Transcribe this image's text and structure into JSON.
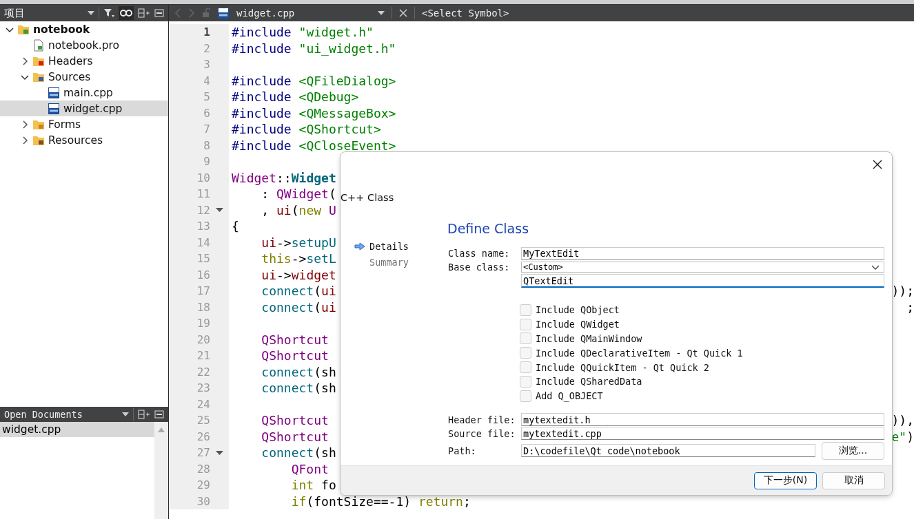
{
  "sidebar": {
    "title": "项目",
    "tree": [
      {
        "label": "notebook",
        "kind": "project",
        "expanded": true,
        "selected": false,
        "children": [
          {
            "label": "notebook.pro",
            "kind": "profile",
            "selected": false
          },
          {
            "label": "Headers",
            "kind": "folder",
            "expanded": false,
            "selected": false
          },
          {
            "label": "Sources",
            "kind": "folder",
            "expanded": true,
            "selected": false,
            "children": [
              {
                "label": "main.cpp",
                "kind": "source",
                "selected": false
              },
              {
                "label": "widget.cpp",
                "kind": "source",
                "selected": true
              }
            ]
          },
          {
            "label": "Forms",
            "kind": "folder",
            "expanded": false,
            "selected": false
          },
          {
            "label": "Resources",
            "kind": "folder",
            "expanded": false,
            "selected": false
          }
        ]
      }
    ]
  },
  "open_documents": {
    "title": "Open Documents",
    "items": [
      {
        "label": "widget.cpp",
        "selected": true
      }
    ]
  },
  "editor_tab": {
    "file": "widget.cpp",
    "symbol": "<Select Symbol>"
  },
  "editor": {
    "lines": [
      {
        "n": "1",
        "current": true,
        "fold": false,
        "code": [
          {
            "kind": "pp",
            "t": "#include"
          },
          {
            "kind": "str",
            "t": " \"widget.h\""
          }
        ]
      },
      {
        "n": "2",
        "current": false,
        "fold": false,
        "code": [
          {
            "kind": "pp",
            "t": "#include"
          },
          {
            "kind": "str",
            "t": " \"ui_widget.h\""
          }
        ]
      },
      {
        "n": "3",
        "current": false,
        "fold": false
      },
      {
        "n": "4",
        "current": false,
        "fold": false,
        "code": [
          {
            "kind": "pp",
            "t": "#include"
          },
          {
            "kind": "str",
            "t": " <QFileDialog>"
          }
        ]
      },
      {
        "n": "5",
        "current": false,
        "fold": false,
        "code": [
          {
            "kind": "pp",
            "t": "#include"
          },
          {
            "kind": "str",
            "t": " <QDebug>"
          }
        ]
      },
      {
        "n": "6",
        "current": false,
        "fold": false,
        "code": [
          {
            "kind": "pp",
            "t": "#include"
          },
          {
            "kind": "str",
            "t": " <QMessageBox>"
          }
        ]
      },
      {
        "n": "7",
        "current": false,
        "fold": false,
        "code": [
          {
            "kind": "pp",
            "t": "#include"
          },
          {
            "kind": "str",
            "t": " <QShortcut>"
          }
        ]
      },
      {
        "n": "8",
        "current": false,
        "fold": false,
        "code": [
          {
            "kind": "pp",
            "t": "#include"
          },
          {
            "kind": "str",
            "t": " <QCloseEvent>"
          }
        ]
      },
      {
        "n": "9",
        "current": false,
        "fold": false
      },
      {
        "n": "10",
        "current": false,
        "fold": false,
        "code": [
          {
            "kind": "type",
            "t": "Widget"
          },
          {
            "kind": "plain",
            "t": "::"
          },
          {
            "kind": "fnb",
            "t": "Widget"
          }
        ]
      },
      {
        "n": "11",
        "current": false,
        "fold": false,
        "code": [
          {
            "kind": "plain",
            "t": "    : "
          },
          {
            "kind": "type",
            "t": "QWidget"
          },
          {
            "kind": "plain",
            "t": "("
          }
        ]
      },
      {
        "n": "12",
        "current": false,
        "fold": true,
        "code": [
          {
            "kind": "plain",
            "t": "    , "
          },
          {
            "kind": "member",
            "t": "ui"
          },
          {
            "kind": "plain",
            "t": "("
          },
          {
            "kind": "kw",
            "t": "new"
          },
          {
            "kind": "type",
            "t": " U"
          }
        ]
      },
      {
        "n": "13",
        "current": false,
        "fold": false,
        "code": [
          {
            "kind": "plain",
            "t": "{"
          }
        ]
      },
      {
        "n": "14",
        "current": false,
        "fold": false,
        "code": [
          {
            "kind": "member",
            "t": "    ui"
          },
          {
            "kind": "plain",
            "t": "->"
          },
          {
            "kind": "fn",
            "t": "setupU"
          }
        ]
      },
      {
        "n": "15",
        "current": false,
        "fold": false,
        "code": [
          {
            "kind": "kw",
            "t": "    this"
          },
          {
            "kind": "plain",
            "t": "->"
          },
          {
            "kind": "fn",
            "t": "setL"
          }
        ]
      },
      {
        "n": "16",
        "current": false,
        "fold": false,
        "code": [
          {
            "kind": "member",
            "t": "    ui"
          },
          {
            "kind": "plain",
            "t": "->"
          },
          {
            "kind": "member",
            "t": "widget"
          }
        ]
      },
      {
        "n": "17",
        "current": false,
        "fold": false,
        "code": [
          {
            "kind": "fn",
            "t": "    connect"
          },
          {
            "kind": "plain",
            "t": "("
          },
          {
            "kind": "member",
            "t": "ui"
          }
        ],
        "tail": [
          {
            "kind": "plain",
            "t": "));"
          }
        ]
      },
      {
        "n": "18",
        "current": false,
        "fold": false,
        "code": [
          {
            "kind": "fn",
            "t": "    connect"
          },
          {
            "kind": "plain",
            "t": "("
          },
          {
            "kind": "member",
            "t": "ui"
          }
        ],
        "tail": [
          {
            "kind": "plain",
            "t": ";"
          }
        ]
      },
      {
        "n": "19",
        "current": false,
        "fold": false
      },
      {
        "n": "20",
        "current": false,
        "fold": false,
        "code": [
          {
            "kind": "type",
            "t": "    QShortcut"
          }
        ]
      },
      {
        "n": "21",
        "current": false,
        "fold": false,
        "code": [
          {
            "kind": "type",
            "t": "    QShortcut"
          }
        ]
      },
      {
        "n": "22",
        "current": false,
        "fold": false,
        "code": [
          {
            "kind": "fn",
            "t": "    connect"
          },
          {
            "kind": "plain",
            "t": "(sh"
          }
        ]
      },
      {
        "n": "23",
        "current": false,
        "fold": false,
        "code": [
          {
            "kind": "fn",
            "t": "    connect"
          },
          {
            "kind": "plain",
            "t": "(sh"
          }
        ]
      },
      {
        "n": "24",
        "current": false,
        "fold": false
      },
      {
        "n": "25",
        "current": false,
        "fold": false,
        "code": [
          {
            "kind": "type",
            "t": "    QShortcut"
          }
        ],
        "tail": [
          {
            "kind": "plain",
            "t": ")),"
          }
        ]
      },
      {
        "n": "26",
        "current": false,
        "fold": false,
        "code": [
          {
            "kind": "type",
            "t": "    QShortcut"
          }
        ],
        "tail": [
          {
            "kind": "str",
            "t": "e\""
          },
          {
            "kind": "plain",
            "t": ")"
          }
        ]
      },
      {
        "n": "27",
        "current": false,
        "fold": true,
        "code": [
          {
            "kind": "fn",
            "t": "    connect"
          },
          {
            "kind": "plain",
            "t": "(sh"
          }
        ]
      },
      {
        "n": "28",
        "current": false,
        "fold": false,
        "code": [
          {
            "kind": "type",
            "t": "        QFont"
          }
        ]
      },
      {
        "n": "29",
        "current": false,
        "fold": false,
        "code": [
          {
            "kind": "kw",
            "t": "        int"
          },
          {
            "kind": "plain",
            "t": " fo"
          }
        ]
      },
      {
        "n": "30",
        "current": false,
        "fold": false,
        "code": [
          {
            "kind": "kw",
            "t": "        if"
          },
          {
            "kind": "plain",
            "t": "(fontSize==-1) "
          },
          {
            "kind": "kw",
            "t": "return"
          },
          {
            "kind": "plain",
            "t": ";"
          }
        ]
      }
    ]
  },
  "dialog": {
    "title": "C++ Class",
    "steps": [
      {
        "label": "Details",
        "selected": true
      },
      {
        "label": "Summary",
        "selected": false
      }
    ],
    "heading": "Define Class",
    "class_name": {
      "label": "Class name:",
      "value": "MyTextEdit"
    },
    "base_class": {
      "label": "Base class:",
      "value": "<Custom>"
    },
    "custom_base": {
      "value": "QTextEdit"
    },
    "options": [
      {
        "label": "Include QObject",
        "checked": false
      },
      {
        "label": "Include QWidget",
        "checked": false
      },
      {
        "label": "Include QMainWindow",
        "checked": false
      },
      {
        "label": "Include QDeclarativeItem - Qt Quick 1",
        "checked": false
      },
      {
        "label": "Include QQuickItem - Qt Quick 2",
        "checked": false
      },
      {
        "label": "Include QSharedData",
        "checked": false
      },
      {
        "label": "Add Q_OBJECT",
        "checked": false
      }
    ],
    "header_file": {
      "label": "Header file:",
      "value": "mytextedit.h"
    },
    "source_file": {
      "label": "Source file:",
      "value": "mytextedit.cpp"
    },
    "path": {
      "label": "Path:",
      "value": "D:\\codefile\\Qt code\\notebook",
      "browse": "浏览..."
    },
    "buttons": [
      {
        "label": "下一步(N)",
        "default": true
      },
      {
        "label": "取消",
        "default": false
      }
    ]
  }
}
